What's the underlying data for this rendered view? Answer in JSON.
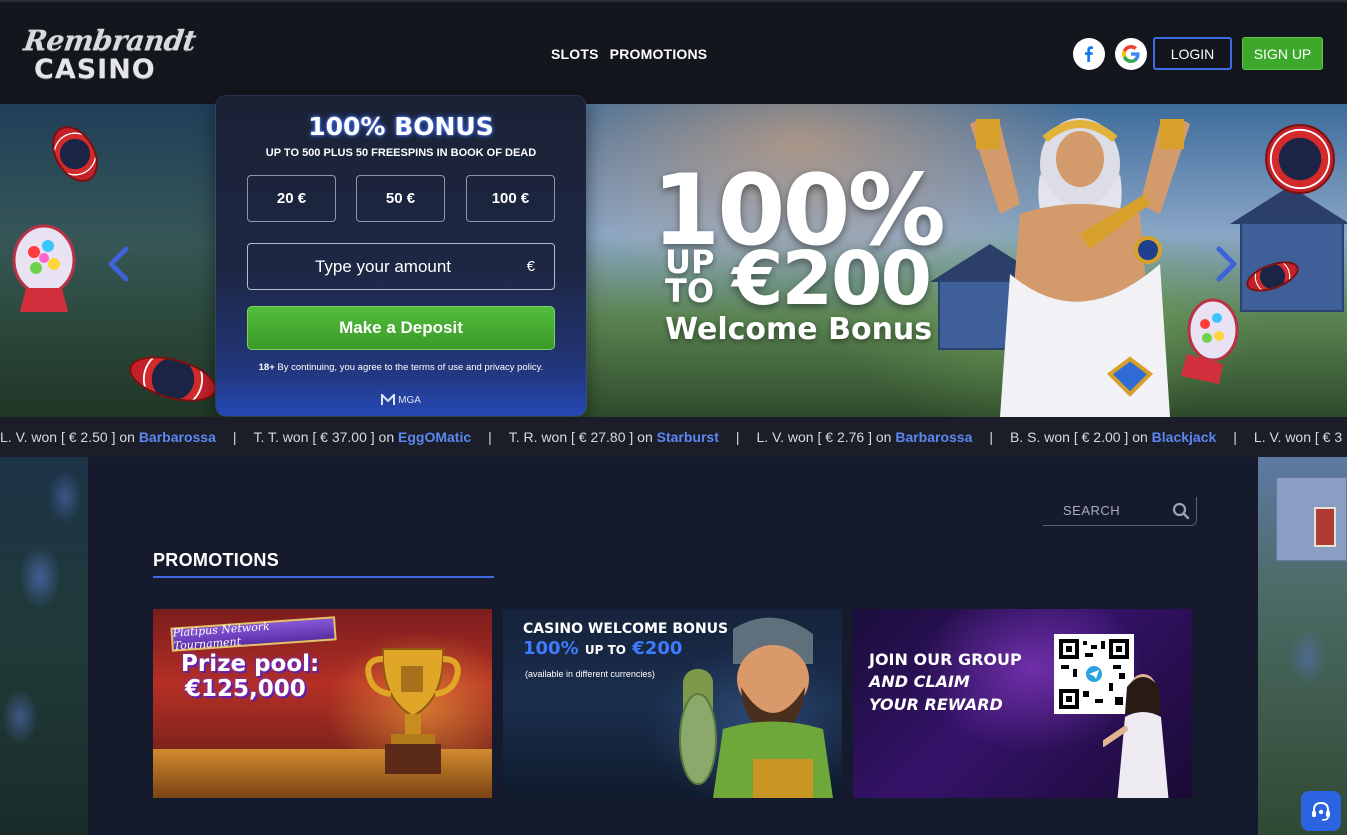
{
  "brand": {
    "logo_script": "Rembrandt",
    "logo_word": "CASINO"
  },
  "nav": {
    "items": [
      "SLOTS",
      "PROMOTIONS"
    ]
  },
  "auth": {
    "login_label": "LOGIN",
    "signup_label": "SIGN UP",
    "social_icons": [
      "facebook-icon",
      "google-icon"
    ]
  },
  "hero": {
    "title": "100%",
    "up_line1": "UP",
    "up_line2": "TO",
    "amount": "€200",
    "subtitle": "Welcome Bonus"
  },
  "deposit": {
    "title": "100% BONUS",
    "subtitle": "UP TO 500 PLUS 50 FREESPINS IN BOOK OF DEAD",
    "amounts": [
      "20 €",
      "50 €",
      "100 €"
    ],
    "amount_placeholder": "Type your amount",
    "currency": "€",
    "button_label": "Make a Deposit",
    "age": "18+",
    "terms": "By continuing, you agree to the terms of use and privacy policy.",
    "license": "MGA"
  },
  "ticker": {
    "items": [
      {
        "player": "L. V. won [ € 2.50 ] on",
        "game": "Barbarossa"
      },
      {
        "player": "T. T. won [ € 37.00 ] on",
        "game": "EggOMatic"
      },
      {
        "player": "T. R. won [ € 27.80 ] on",
        "game": "Starburst"
      },
      {
        "player": "L. V. won [ € 2.76 ] on",
        "game": "Barbarossa"
      },
      {
        "player": "B. S. won [ € 2.00 ] on",
        "game": "Blackjack"
      },
      {
        "player": "L. V. won [ € 3",
        "game": ""
      }
    ],
    "separator": "|"
  },
  "search": {
    "placeholder": "SEARCH"
  },
  "promotions": {
    "title": "PROMOTIONS",
    "cards": [
      {
        "banner": "Platipus Network Tournament",
        "line1": "Prize pool:",
        "line2": "€125,000"
      },
      {
        "line1": "CASINO WELCOME BONUS",
        "line2_accent": "100%",
        "line2_mid": "UP TO",
        "line2_amount": "€200",
        "note": "(available in different currencies)"
      },
      {
        "line1": "JOIN OUR GROUP",
        "line2": "AND CLAIM",
        "line3": "YOUR REWARD"
      }
    ]
  },
  "colors": {
    "accent_blue": "#3d6ae4",
    "signup_green": "#3ea82c",
    "link_blue": "#5b87f0",
    "header_bg": "#14161d",
    "panel_bg": "#151a2d"
  }
}
